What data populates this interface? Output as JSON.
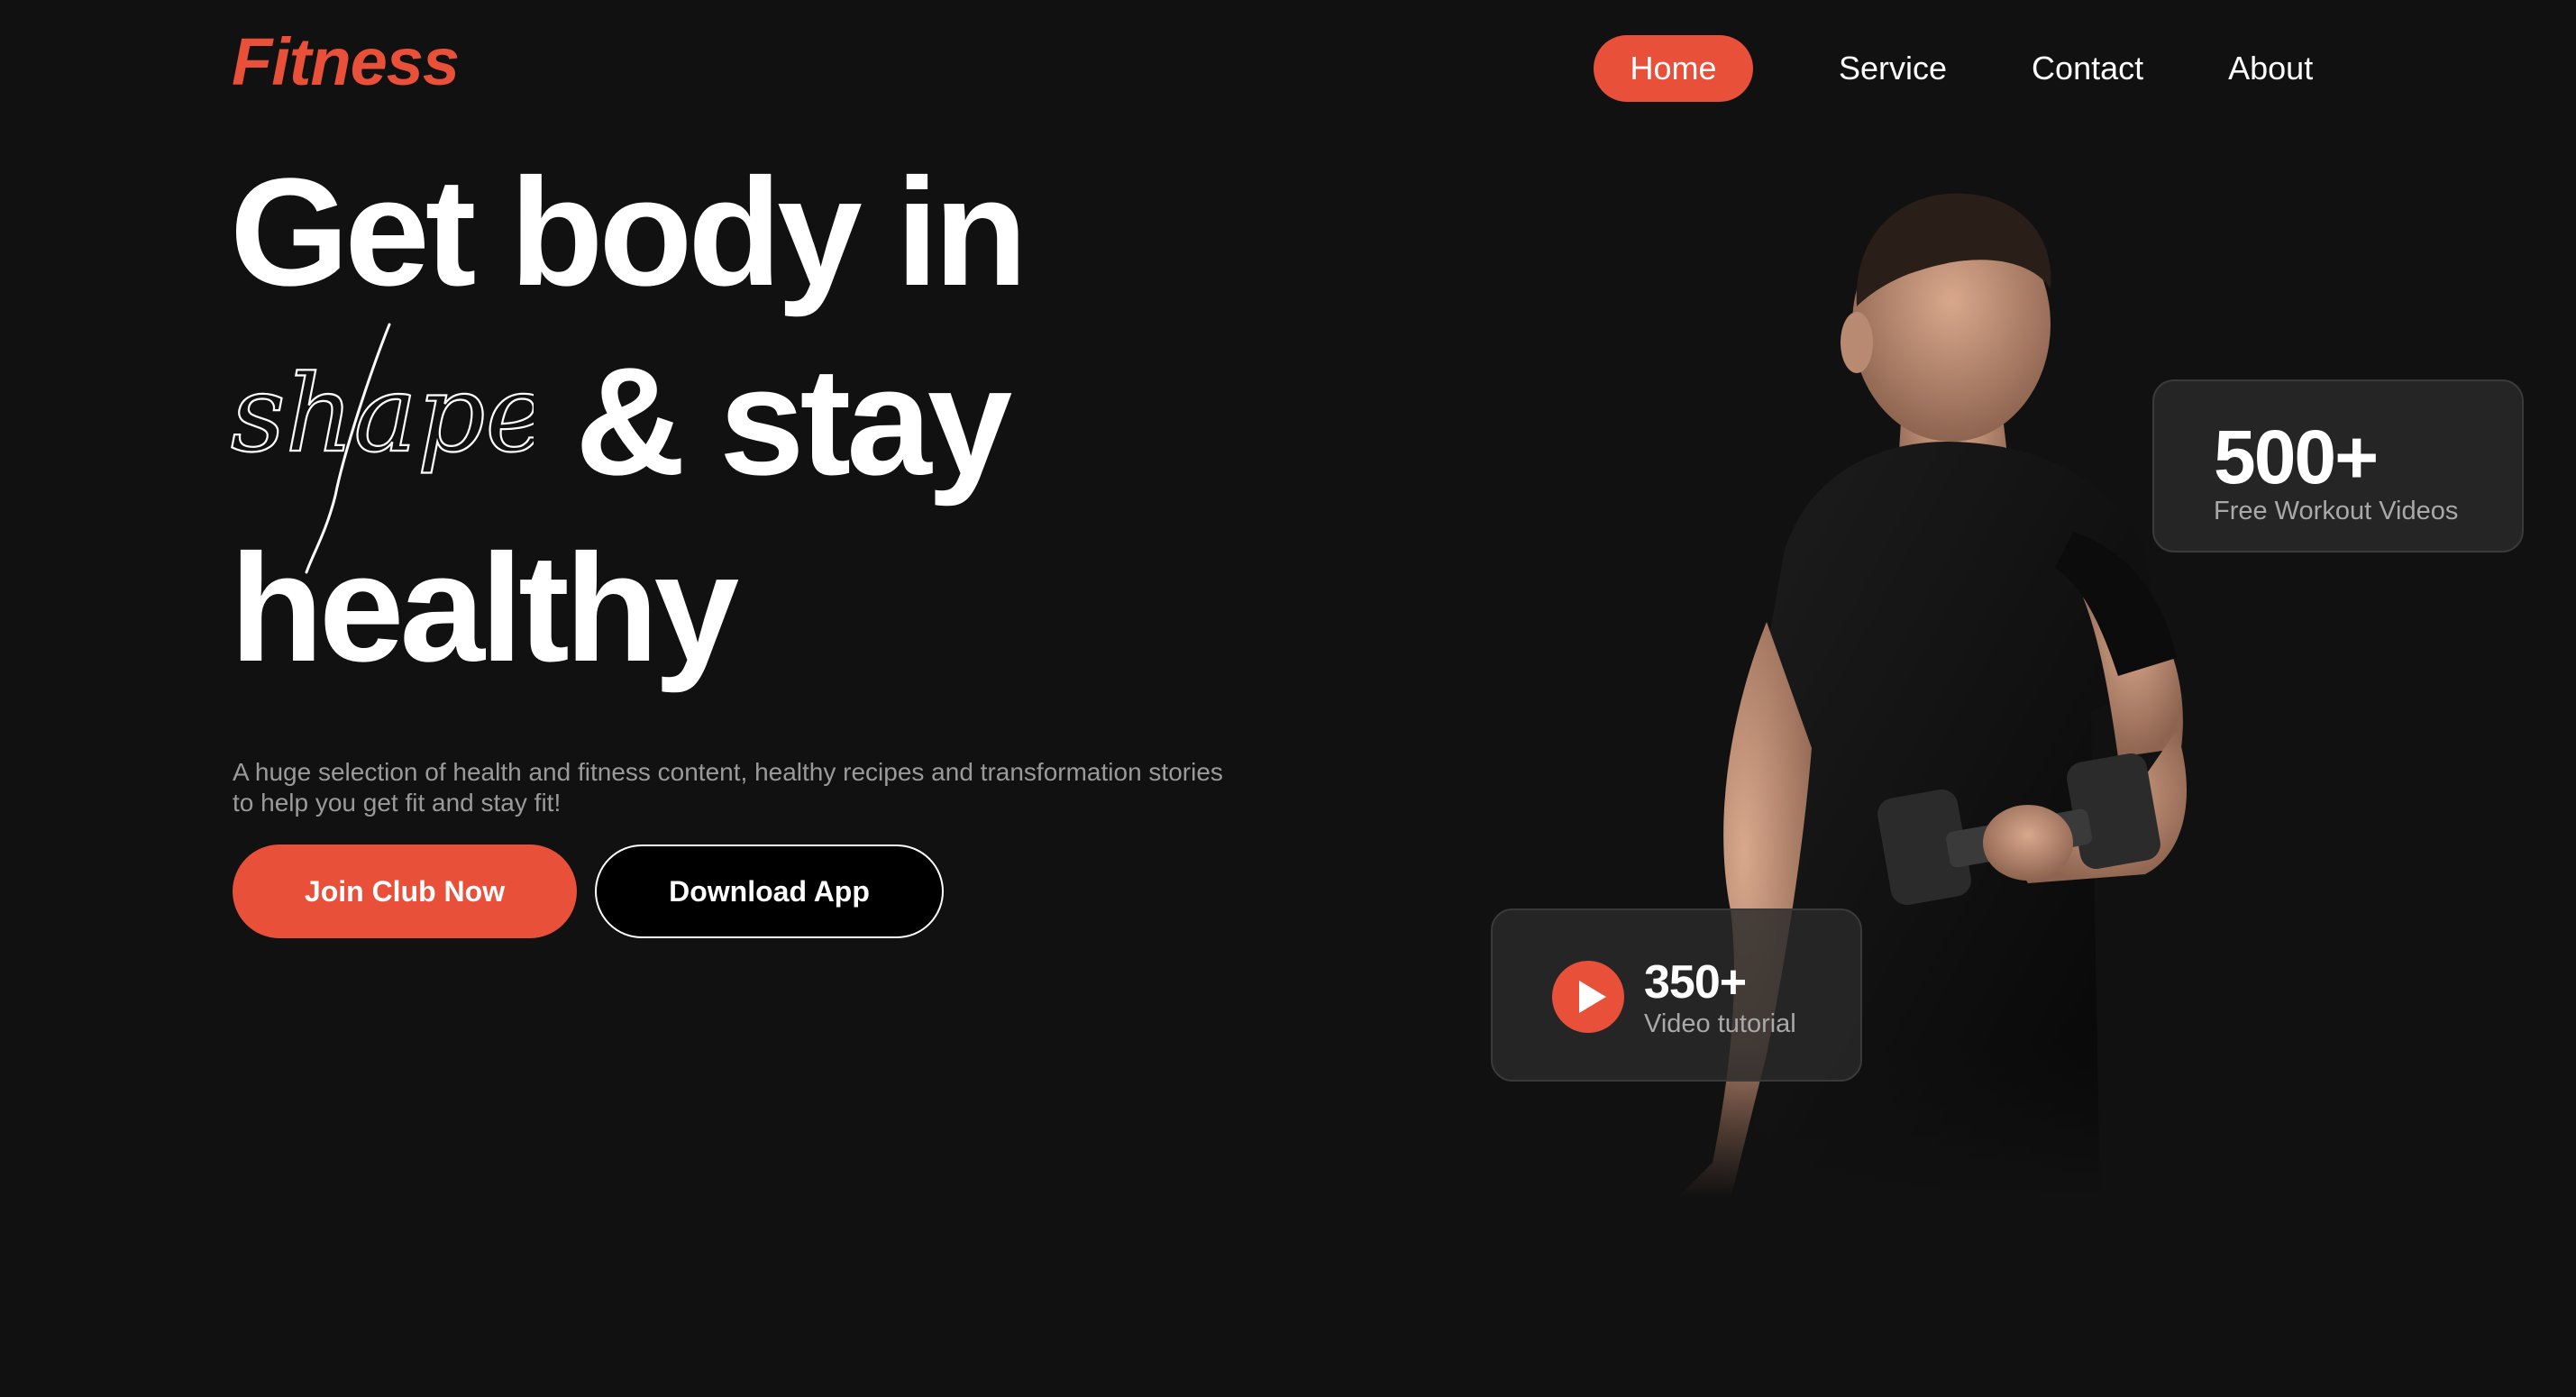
{
  "brand": {
    "logo": "Fitness",
    "accent_color": "#e8503a",
    "background_color": "#111111"
  },
  "nav": {
    "items": [
      {
        "label": "Home",
        "active": true
      },
      {
        "label": "Service",
        "active": false
      },
      {
        "label": "Contact",
        "active": false
      },
      {
        "label": "About",
        "active": false
      }
    ]
  },
  "hero": {
    "headline_line_1": "Get body in",
    "headline_script_word": "shape",
    "headline_line_2": "& stay",
    "headline_line_3": "healthy",
    "description": "A huge selection of health and fitness content, healthy recipes and transformation stories to help you get fit and stay fit!",
    "primary_button": "Join Club Now",
    "secondary_button": "Download App",
    "image": "man-lifting-dumbbell"
  },
  "stats": {
    "workouts": {
      "number": "500+",
      "label": "Free Workout Videos"
    },
    "tutorials": {
      "number": "350+",
      "label": "Video tutorial",
      "icon": "play-icon"
    }
  }
}
